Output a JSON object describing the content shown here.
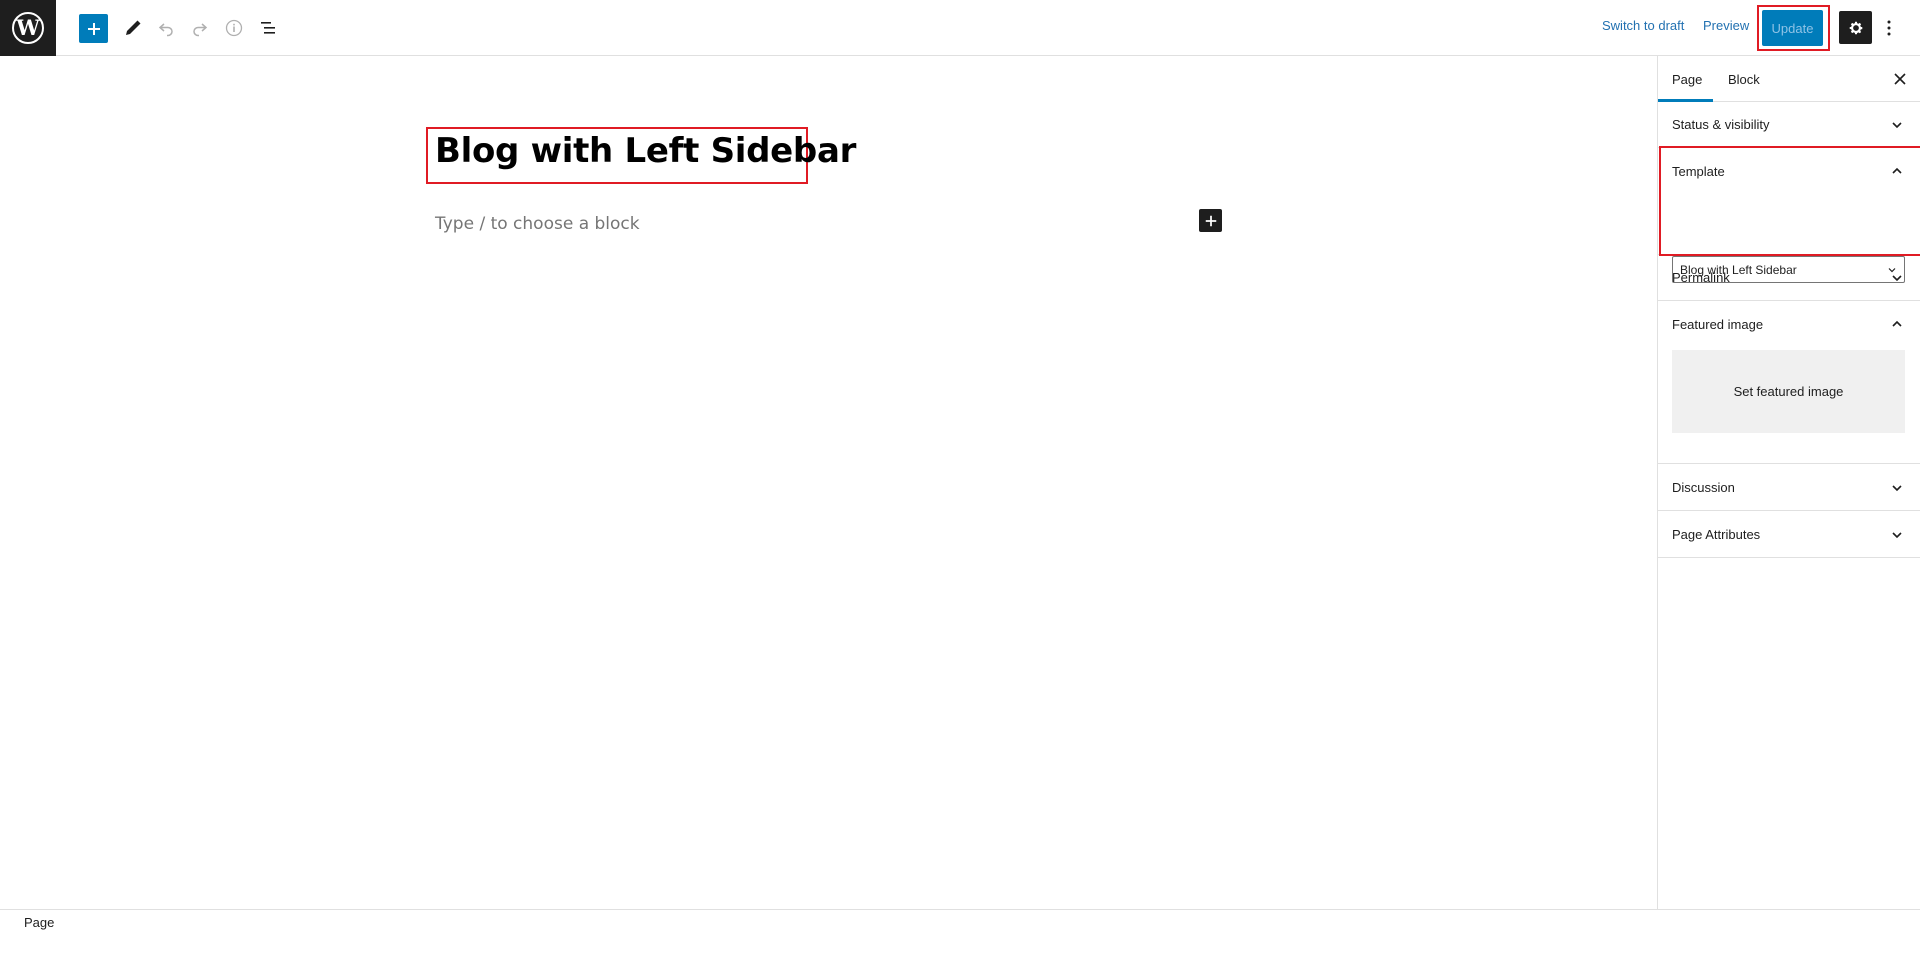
{
  "toolbar": {
    "logo_icon": "wordpress-icon",
    "inserter_icon": "plus-icon",
    "tools_icon": "pencil-icon",
    "undo_icon": "undo-icon",
    "redo_icon": "redo-icon",
    "info_icon": "info-icon",
    "list_view_icon": "list-view-icon",
    "switch_to_draft_label": "Switch to draft",
    "preview_label": "Preview",
    "update_label": "Update",
    "settings_icon": "gear-icon",
    "more_icon": "more-vertical-icon",
    "accent_color": "#007cba"
  },
  "editor": {
    "title": "Blog with Left Sidebar",
    "block_placeholder": "Type / to choose a block",
    "inserter_icon": "plus-icon"
  },
  "sidebar": {
    "tabs": [
      {
        "label": "Page",
        "active": true
      },
      {
        "label": "Block",
        "active": false
      }
    ],
    "close_icon": "close-icon",
    "panels": {
      "status_visibility": {
        "label": "Status & visibility",
        "expanded": false
      },
      "template": {
        "label": "Template",
        "expanded": true,
        "selected": "Blog with Left Sidebar"
      },
      "permalink": {
        "label": "Permalink",
        "expanded": false
      },
      "featured_image": {
        "label": "Featured image",
        "expanded": true,
        "button_label": "Set featured image"
      },
      "discussion": {
        "label": "Discussion",
        "expanded": false
      },
      "page_attributes": {
        "label": "Page Attributes",
        "expanded": false
      }
    }
  },
  "footer": {
    "breadcrumb": "Page"
  }
}
